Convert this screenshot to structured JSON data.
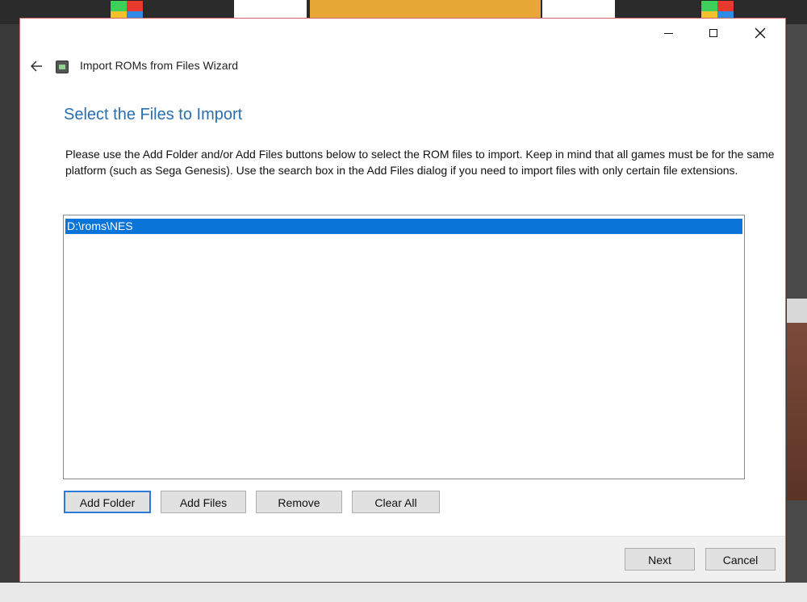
{
  "window": {
    "title": "Import ROMs from Files Wizard"
  },
  "page": {
    "heading": "Select the Files to Import",
    "description": "Please use the Add Folder and/or Add Files buttons below to select the ROM files to import. Keep in mind that all games must be for the same platform (such as Sega Genesis). Use the search box in the Add Files dialog if you need to import files with only certain file extensions."
  },
  "file_list": {
    "items": [
      {
        "path": "D:\\roms\\NES",
        "selected": true
      }
    ]
  },
  "actions": {
    "add_folder": "Add Folder",
    "add_files": "Add Files",
    "remove": "Remove",
    "clear_all": "Clear All"
  },
  "footer": {
    "next": "Next",
    "cancel": "Cancel"
  },
  "icons": {
    "back": "back-arrow-icon",
    "app": "app-icon",
    "minimize": "minimize-icon",
    "maximize": "maximize-icon",
    "close": "close-icon"
  },
  "colors": {
    "heading": "#2a6fb0",
    "selection": "#0a74d8",
    "default_button_border": "#2c7ad6"
  }
}
